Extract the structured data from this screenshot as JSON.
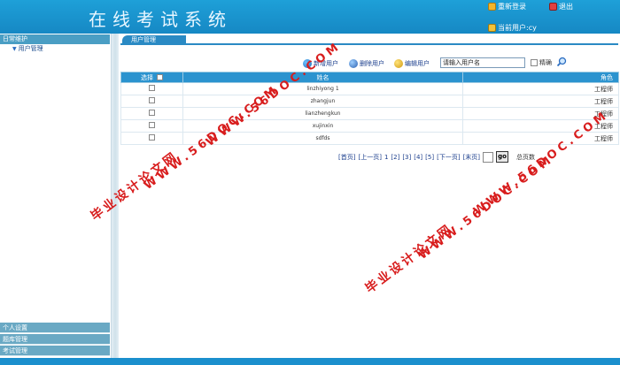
{
  "header": {
    "title": "在线考试系统",
    "relogin_label": "重新登录",
    "exit_label": "退出",
    "current_user": "当前用户:cy"
  },
  "sidebar": {
    "section_title": "日常维护",
    "items": [
      {
        "label": "用户管理"
      }
    ],
    "bottom_sections": [
      {
        "label": "个人设置"
      },
      {
        "label": "题库管理"
      },
      {
        "label": "考试管理"
      }
    ]
  },
  "main": {
    "tab_label": "用户管理",
    "toolbar": {
      "add_label": "新增用户",
      "delete_label": "删除用户",
      "edit_label": "编辑用户",
      "search_value": "请输入用户名",
      "exact_label": "精确"
    },
    "table": {
      "columns": [
        "选择",
        "姓名",
        "角色"
      ],
      "rows": [
        {
          "name": "linzhiyong 1",
          "role": "工程师"
        },
        {
          "name": "zhangjun",
          "role": "工程师"
        },
        {
          "name": "lianzhengkun",
          "role": "工程师"
        },
        {
          "name": "xujinxin",
          "role": "工程师"
        },
        {
          "name": "sdfds",
          "role": "工程师"
        }
      ]
    },
    "pager": {
      "first": "[首页]",
      "prev": "[上一页]",
      "current": "1",
      "pages": [
        "[2]",
        "[3]",
        "[4]",
        "[5]"
      ],
      "next": "[下一页]",
      "last": "[末页]",
      "go_label": "go",
      "total_label": "总页数"
    }
  },
  "watermarks": {
    "cn": "毕业设计论文网",
    "en": "WWW.56DOC.COM"
  },
  "colors": {
    "header_blue": "#1b8fcd",
    "table_header": "#2b93cf",
    "watermark_red": "#d81d1d"
  }
}
